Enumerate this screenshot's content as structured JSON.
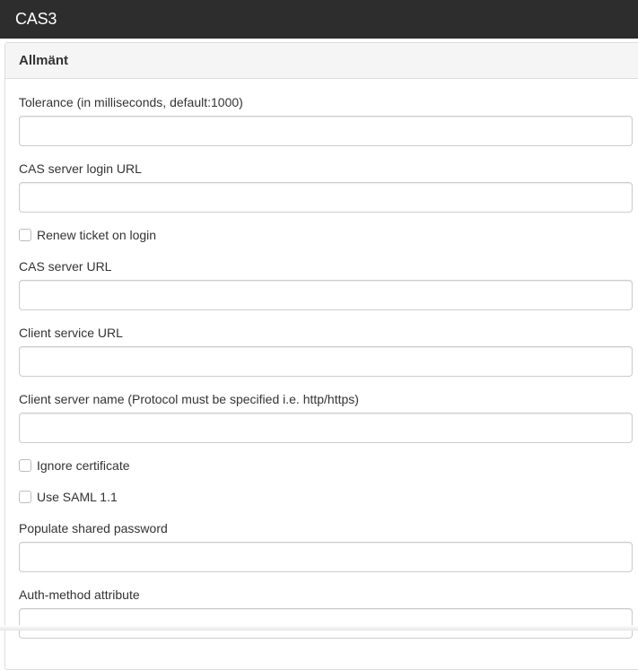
{
  "header": {
    "title": "CAS3"
  },
  "panel": {
    "heading": "Allmänt",
    "fields": [
      {
        "label": "Tolerance (in milliseconds, default:1000)",
        "value": ""
      },
      {
        "label": "CAS server login URL",
        "value": ""
      },
      {
        "label": "CAS server URL",
        "value": ""
      },
      {
        "label": "Client service URL",
        "value": ""
      },
      {
        "label": "Client server name (Protocol must be specified i.e. http/https)",
        "value": ""
      },
      {
        "label": "Populate shared password",
        "value": ""
      },
      {
        "label": "Auth-method attribute",
        "value": ""
      }
    ],
    "checkboxes": [
      {
        "label": "Renew ticket on login",
        "checked": false
      },
      {
        "label": "Ignore certificate",
        "checked": false
      },
      {
        "label": "Use SAML 1.1",
        "checked": false
      }
    ]
  }
}
